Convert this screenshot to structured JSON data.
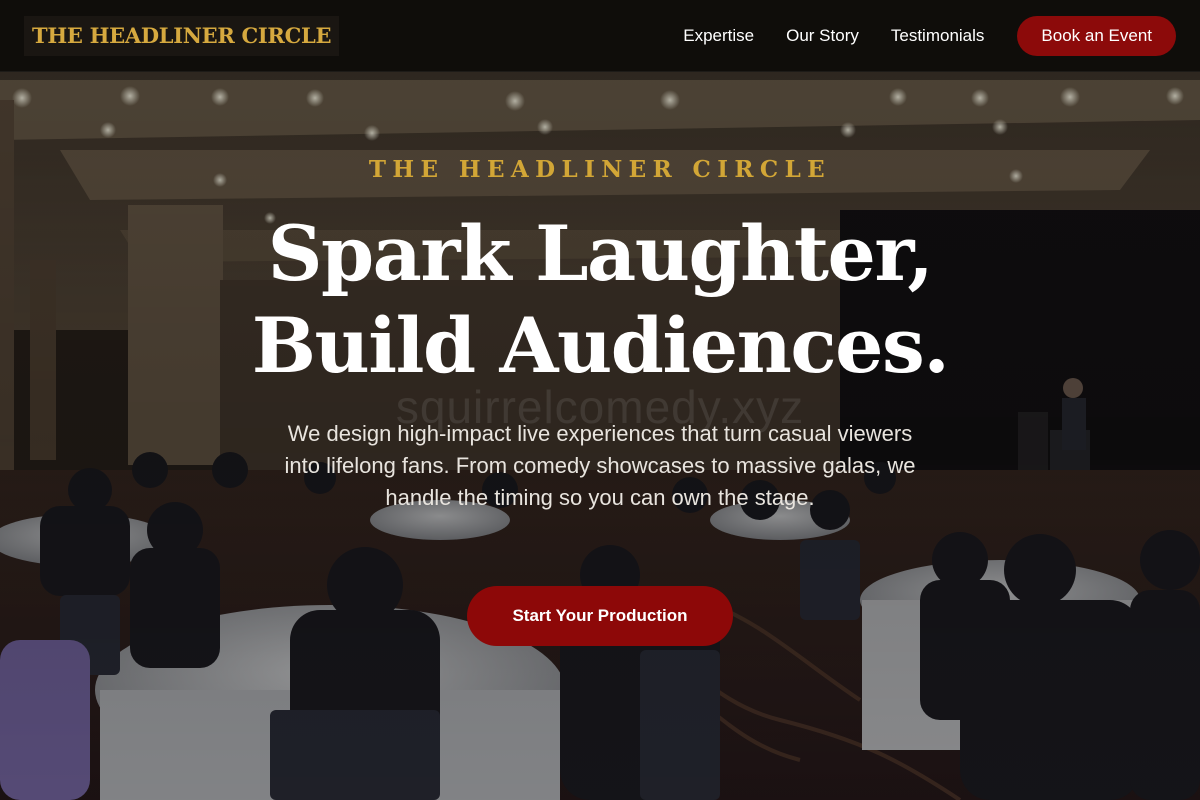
{
  "nav": {
    "brand": "THE HEADLINER CIRCLE",
    "links": [
      "Expertise",
      "Our Story",
      "Testimonials"
    ],
    "cta": "Book an Event"
  },
  "hero": {
    "eyebrow": "THE HEADLINER CIRCLE",
    "headline_line1": "Spark Laughter,",
    "headline_line2": "Build Audiences.",
    "watermark": "squirrelcomedy.xyz",
    "description": "We design high-impact live experiences that turn casual viewers into lifelong fans. From comedy showcases to massive galas, we handle the timing so you can own the stage.",
    "cta": "Start Your Production"
  },
  "colors": {
    "accent_gold": "#d2a636",
    "brand_red": "#8c0a0a",
    "nav_background": "#0e0c0a"
  }
}
